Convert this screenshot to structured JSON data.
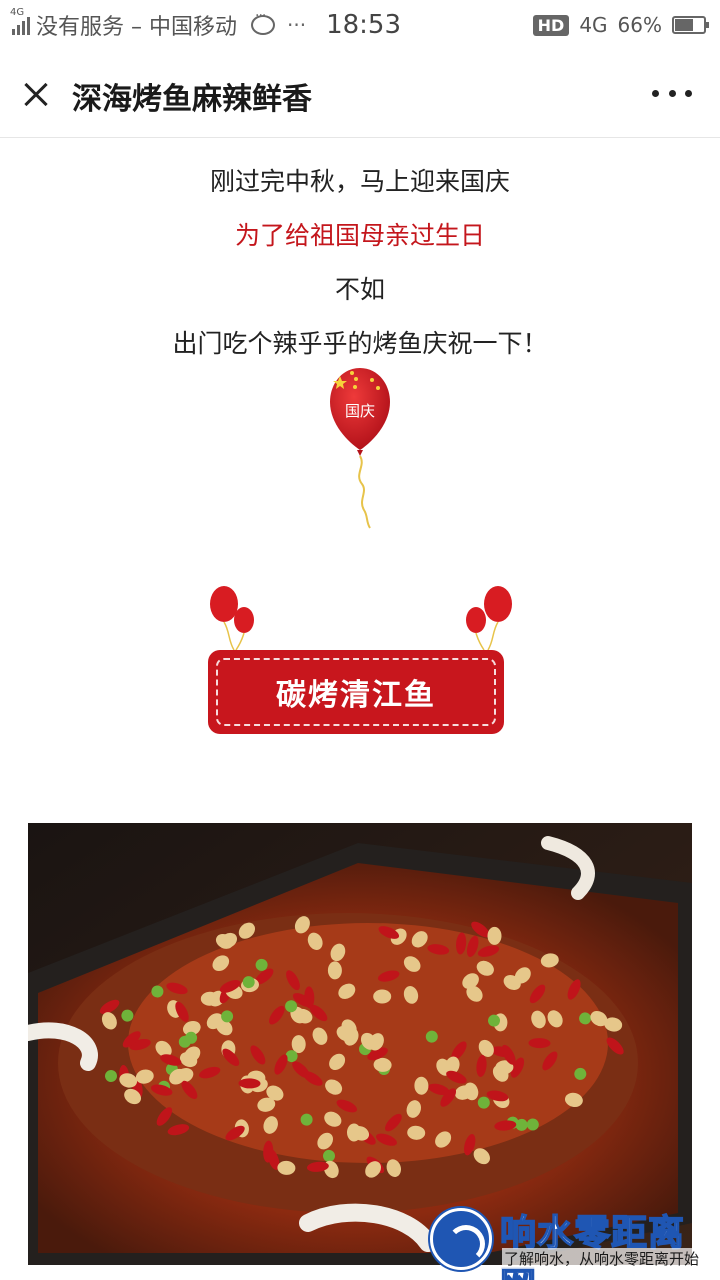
{
  "status_bar": {
    "network_small": "4G",
    "carrier": "没有服务 – 中国移动",
    "overflow": "···",
    "time": "18:53",
    "hd": "HD",
    "network": "4G",
    "battery_percent": "66%",
    "battery_level": 0.66
  },
  "nav": {
    "title": "深海烤鱼麻辣鲜香"
  },
  "article": {
    "line1": "刚过完中秋，马上迎来国庆",
    "line2": "为了给祖国母亲过生日",
    "line3": "不如",
    "line4": "出门吃个辣乎乎的烤鱼庆祝一下！",
    "balloon_label": "国庆",
    "banner_label": "碳烤清江鱼"
  },
  "colors": {
    "accent_red": "#c4161c",
    "watermark_blue": "#1f56b3"
  },
  "watermark": {
    "title": "响水零距离网",
    "subtitle": "了解响水，从响水零距离开始"
  }
}
